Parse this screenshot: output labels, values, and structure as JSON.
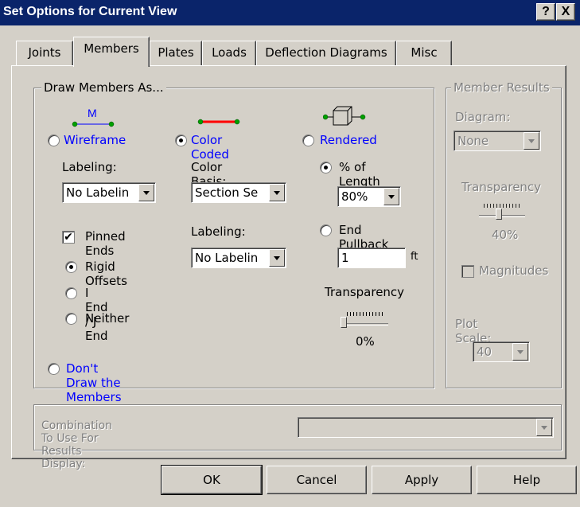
{
  "window": {
    "title": "Set Options for Current View",
    "help_button": "?",
    "close_button": "X"
  },
  "tabs": [
    {
      "label": "Joints",
      "active": false
    },
    {
      "label": "Members",
      "active": true
    },
    {
      "label": "Plates",
      "active": false
    },
    {
      "label": "Loads",
      "active": false
    },
    {
      "label": "Deflection Diagrams",
      "active": false
    },
    {
      "label": "Misc",
      "active": false
    }
  ],
  "draw_members": {
    "group_title": "Draw Members As...",
    "wireframe_label": "Wireframe",
    "wireframe_icon_letter": "M",
    "color_coded_label": "Color Coded",
    "rendered_label": "Rendered",
    "selected_mode": "Color Coded",
    "wireframe": {
      "labeling_title": "Labeling:",
      "labeling_value": "No Labelin",
      "pinned_ends_label": "Pinned Ends",
      "pinned_ends_checked": true,
      "offset_options": [
        "Rigid Offsets",
        "I End / J End",
        "Neither"
      ],
      "offset_selected": "Rigid Offsets"
    },
    "color_coded": {
      "basis_title": "Color Basis:",
      "basis_value": "Section Se",
      "labeling_title": "Labeling:",
      "labeling_value": "No Labelin"
    },
    "rendered": {
      "length_label": "% of Length",
      "length_value": "80%",
      "pullback_label": "End Pullback",
      "pullback_value": "1",
      "pullback_unit": "ft",
      "selected": "% of Length",
      "transparency_title": "Transparency",
      "transparency_value": "0%",
      "transparency_level": 0
    },
    "dont_draw_label": "Don't Draw the Members"
  },
  "member_results": {
    "group_title": "Member Results",
    "diagram_title": "Diagram:",
    "diagram_value": "None",
    "transparency_title": "Transparency",
    "transparency_value": "40%",
    "transparency_level": 0.4,
    "magnitudes_label": "Magnitudes",
    "plot_scale_title": "Plot Scale:",
    "plot_scale_value": "40"
  },
  "combination": {
    "label": "Combination To Use For Results Display:",
    "value": ""
  },
  "buttons": {
    "ok": "OK",
    "cancel": "Cancel",
    "apply": "Apply",
    "help": "Help"
  },
  "colors": {
    "title_bar": "#0a246a",
    "link_blue": "#0000ff",
    "color_coded_line": "#ff0000",
    "node_green": "#00a000"
  }
}
